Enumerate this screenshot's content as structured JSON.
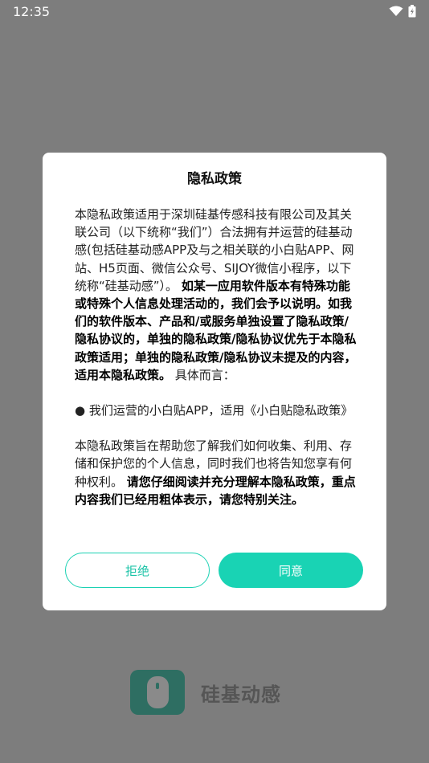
{
  "status_bar": {
    "time": "12:35"
  },
  "dialog": {
    "title": "隐私政策",
    "para1_normal_a": "本隐私政策适用于深圳硅基传感科技有限公司及其关联公司（以下统称“我们”）合法拥有并运营的硅基动感(包括硅基动感APP及与之相关联的小白贴APP、网站、H5页面、微信公众号、SIJOY微信小程序，以下统称“硅基动感”）。",
    "para1_bold": "如某一应用软件版本有特殊功能或特殊个人信息处理活动的，我们会予以说明。如我们的软件版本、产品和/或服务单独设置了隐私政策/隐私协议的，单独的隐私政策/隐私协议优先于本隐私政策适用；单独的隐私政策/隐私协议未提及的内容，适用本隐私政策。",
    "para1_normal_b": "具体而言：",
    "para2": "● 我们运营的小白贴APP，适用《小白贴隐私政策》",
    "para3_normal": "本隐私政策旨在帮助您了解我们如何收集、利用、存储和保护您的个人信息，同时我们也将告知您享有何种权利。",
    "para3_bold": "请您仔细阅读并充分理解本隐私政策，重点内容我们已经用粗体表示，请您特别关注。",
    "reject_label": "拒绝",
    "accept_label": "同意"
  },
  "brand": {
    "name": "硅基动感"
  },
  "colors": {
    "accent": "#19d3b4",
    "overlay": "#7d7d7d"
  },
  "icons": {
    "wifi": "wifi-icon",
    "battery": "battery-icon",
    "logo": "app-logo-icon"
  }
}
